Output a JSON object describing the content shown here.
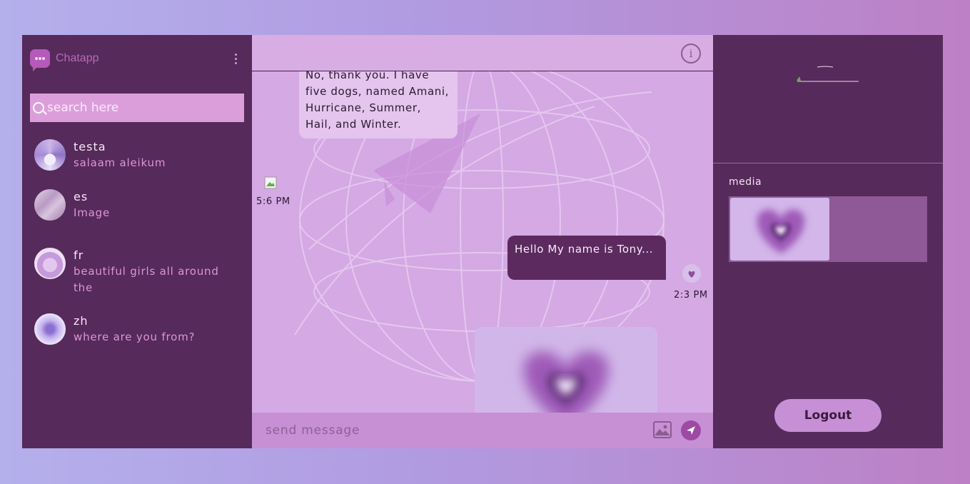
{
  "brand": {
    "name": "Chatapp",
    "accent": "#b55aba"
  },
  "sidebar": {
    "menu_icon": "kebab-menu-icon",
    "search": {
      "placeholder": "search here",
      "icon": "search-icon"
    },
    "contacts": [
      {
        "name": "testa",
        "last_message": "salaam aleikum"
      },
      {
        "name": "es",
        "last_message": "Image"
      },
      {
        "name": "fr",
        "last_message": "beautiful girls all around the"
      },
      {
        "name": "zh",
        "last_message": "where are you from?"
      }
    ]
  },
  "chat": {
    "header": {
      "info_icon": "info-icon"
    },
    "messages": [
      {
        "direction": "incoming",
        "text": "No, thank you. I have five dogs, named Amani, Hurricane, Summer, Hail, and Winter.",
        "time": "5:6 PM"
      },
      {
        "direction": "outgoing",
        "text": "Hello My name is Tony...",
        "time": "2:3 PM"
      },
      {
        "direction": "outgoing",
        "type": "image",
        "image": "purple-heart"
      }
    ],
    "composer": {
      "placeholder": "send message",
      "gallery_icon": "image-icon",
      "send_icon": "send-icon"
    }
  },
  "right_panel": {
    "media_label": "media",
    "logout_label": "Logout"
  },
  "colors": {
    "panel": "#562a5a",
    "chat_bg": "#d4a9e4",
    "search_bg": "#dc9edb",
    "outgoing_bubble": "#5c2a5f",
    "incoming_bubble": "#e5c4ee",
    "composer": "#c78fd4"
  }
}
